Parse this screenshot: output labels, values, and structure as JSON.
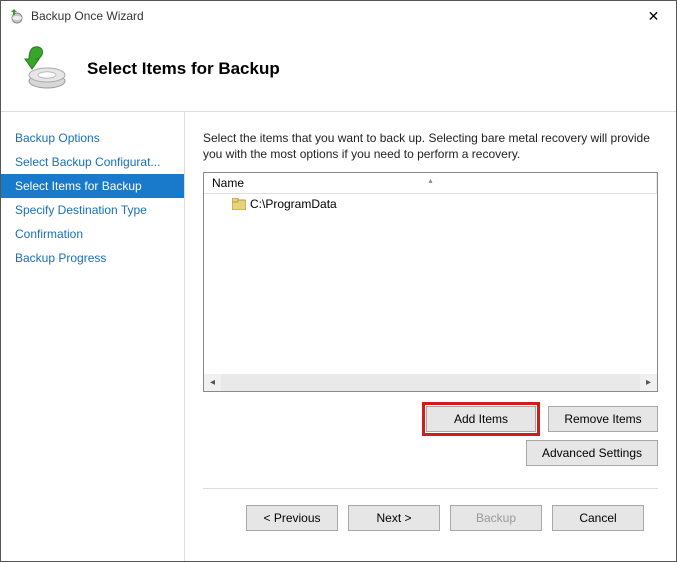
{
  "window": {
    "title": "Backup Once Wizard",
    "close_glyph": "✕"
  },
  "header": {
    "title": "Select Items for Backup"
  },
  "sidebar": {
    "steps": [
      {
        "label": "Backup Options"
      },
      {
        "label": "Select Backup Configurat..."
      },
      {
        "label": "Select Items for Backup",
        "selected": true
      },
      {
        "label": "Specify Destination Type"
      },
      {
        "label": "Confirmation"
      },
      {
        "label": "Backup Progress"
      }
    ]
  },
  "main": {
    "description": "Select the items that you want to back up. Selecting bare metal recovery will provide you with the most options if you need to perform a recovery.",
    "column_name": "Name",
    "items": [
      {
        "path": "C:\\ProgramData"
      }
    ],
    "add_items_label": "Add Items",
    "remove_items_label": "Remove Items",
    "advanced_settings_label": "Advanced Settings"
  },
  "footer": {
    "previous_label": "< Previous",
    "next_label": "Next >",
    "backup_label": "Backup",
    "cancel_label": "Cancel"
  }
}
